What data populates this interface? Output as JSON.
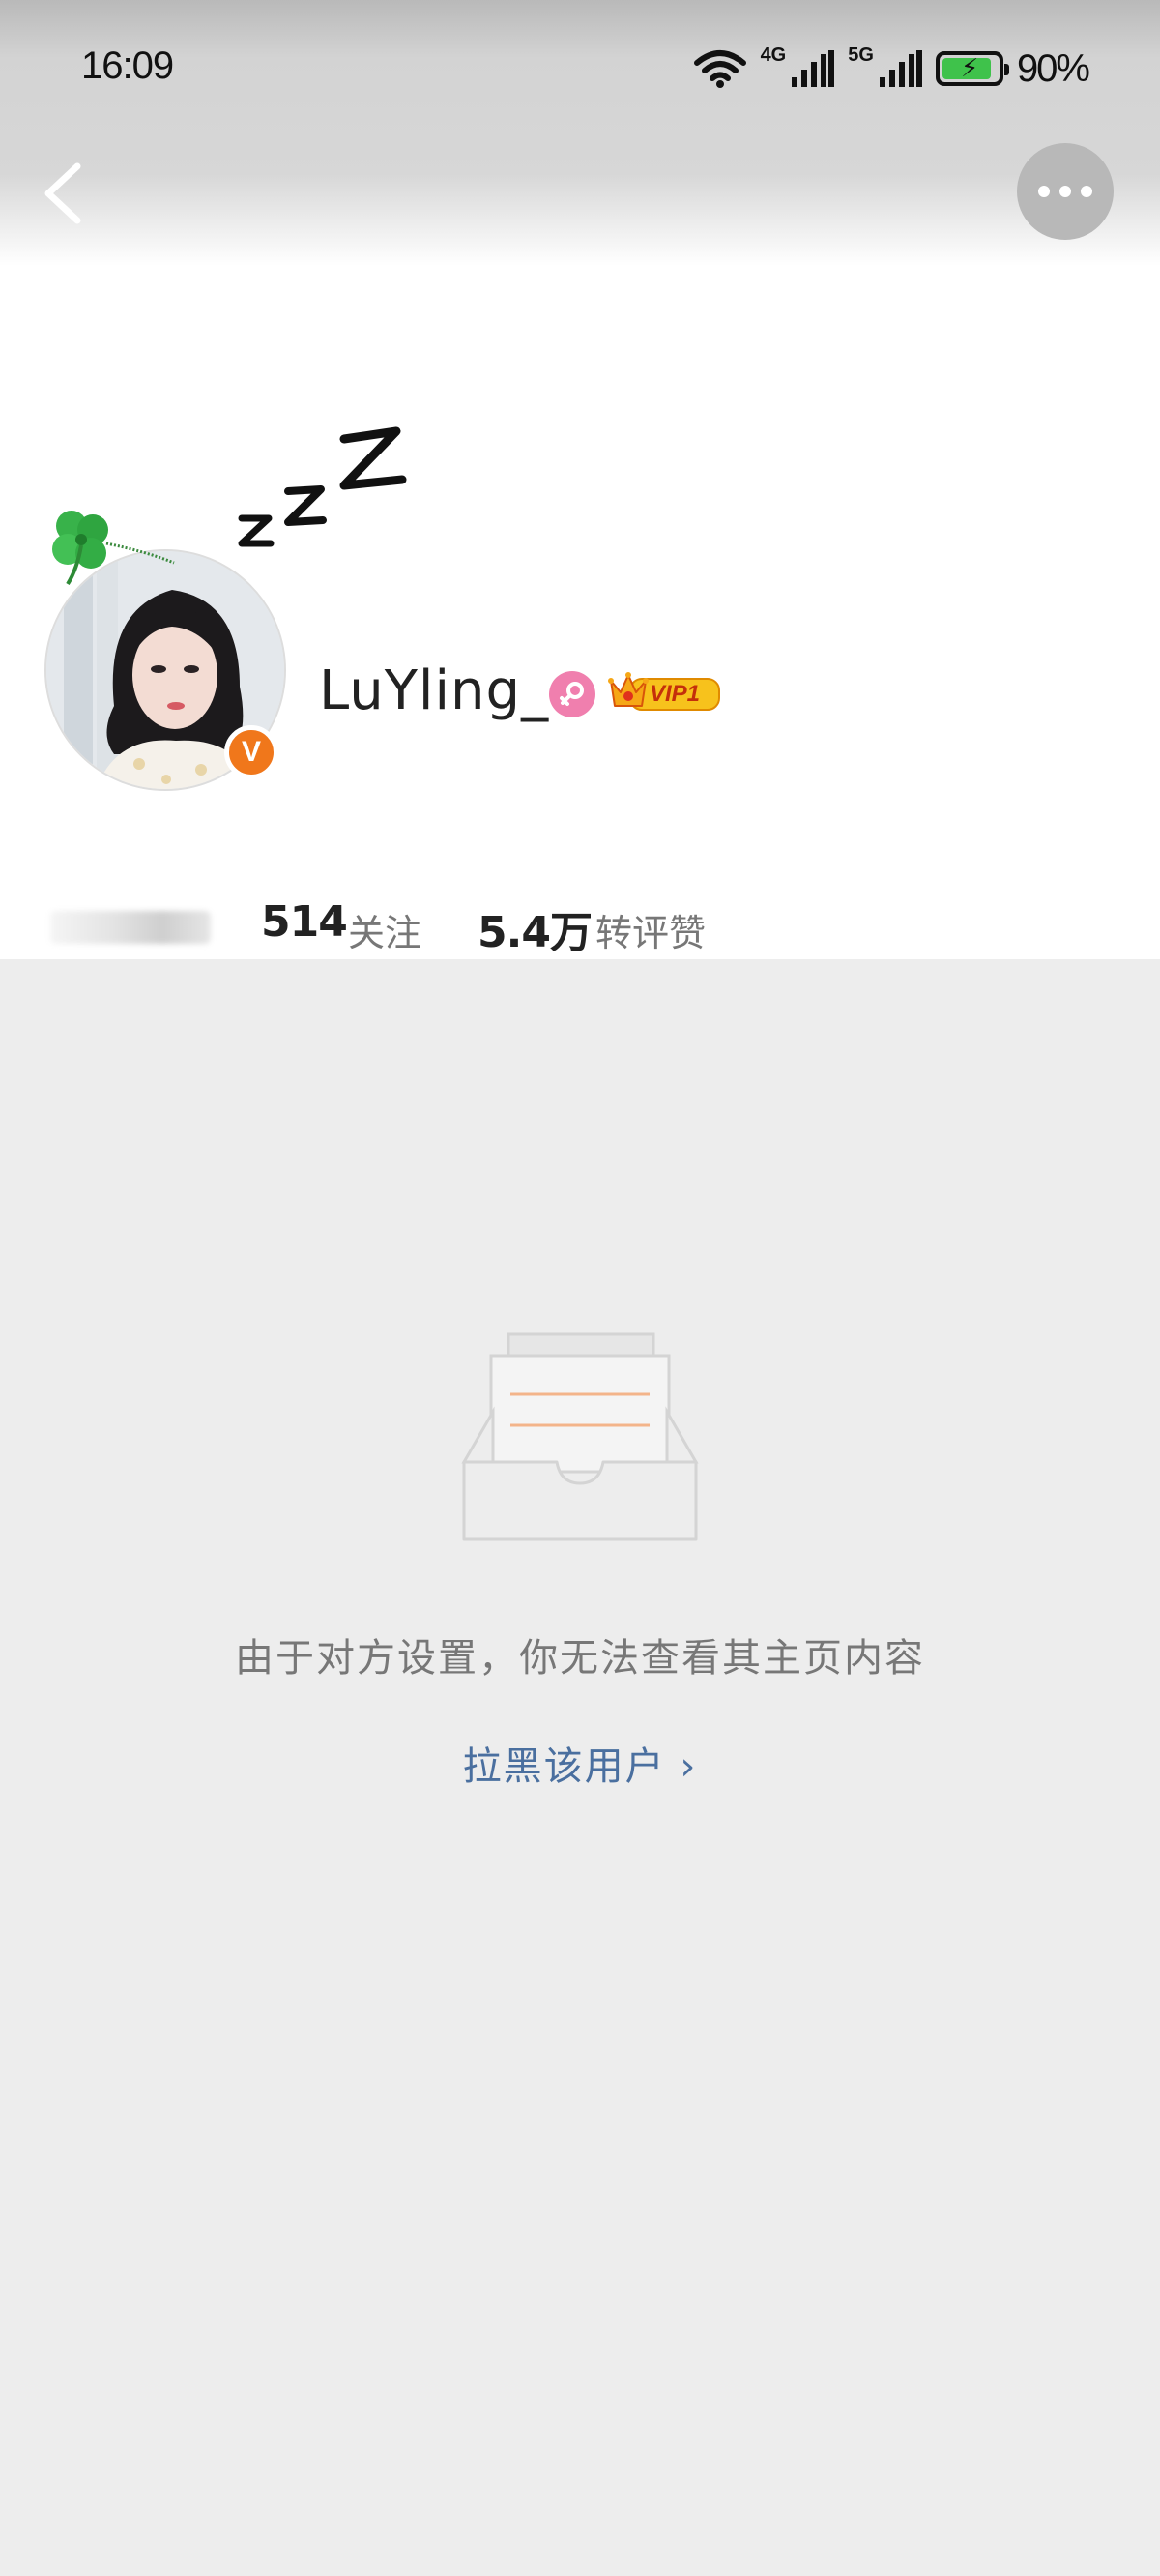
{
  "status_bar": {
    "time": "16:09",
    "network_1": "4G",
    "network_2": "5G",
    "battery_percent": "90%",
    "battery_level": 0.9,
    "icons": [
      "wifi-icon",
      "signal-icon",
      "signal-icon",
      "battery-charging-icon"
    ]
  },
  "nav": {
    "back_icon": "chevron-left-icon",
    "more_icon": "more-horizontal-icon"
  },
  "profile": {
    "username": "LuYling_",
    "gender_icon": "female-icon",
    "verified_badge": "V",
    "vip_label": "VIP1",
    "avatar_decoration": [
      "clover-icon",
      "zzz-sleep-icon"
    ]
  },
  "stats": {
    "following_count": "514",
    "following_label": "关注",
    "likes_count": "5.4万",
    "likes_label": "转评赞"
  },
  "empty_state": {
    "icon": "empty-inbox-icon",
    "message": "由于对方设置，你无法查看其主页内容",
    "action_label": "拉黑该用户 ›"
  },
  "colors": {
    "background": "#ededed",
    "header_background": "#ffffff",
    "link": "#4a6f9f",
    "verified_orange": "#f0771b",
    "gender_pink": "#f07fae",
    "battery_green": "#3fc24b"
  }
}
